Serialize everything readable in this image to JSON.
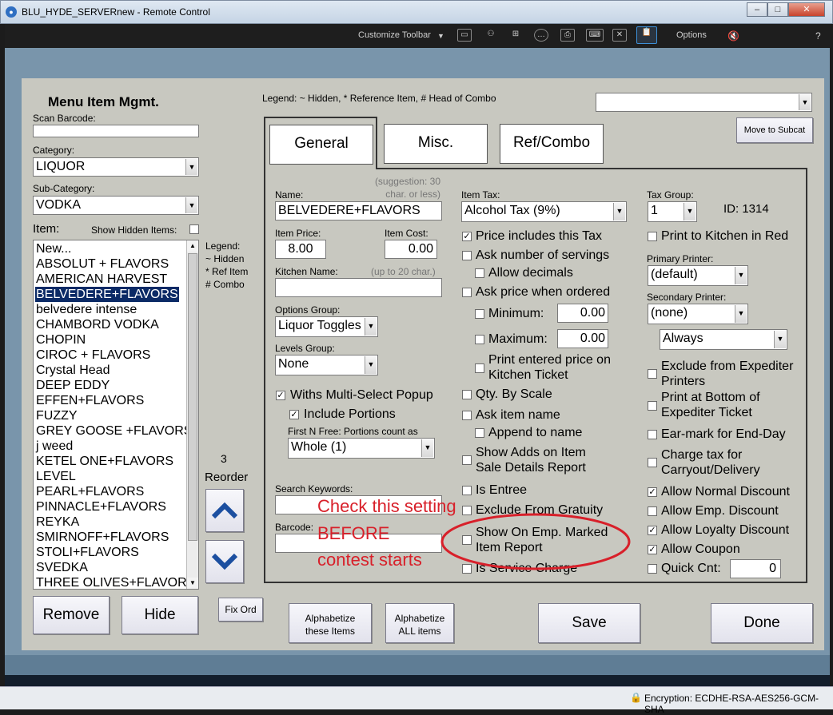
{
  "window": {
    "title": "BLU_HYDE_SERVERnew - Remote Control",
    "min": "–",
    "max": "□",
    "close": "✕"
  },
  "toolbar": {
    "customize": "Customize Toolbar",
    "options": "Options",
    "help": "?"
  },
  "status": {
    "encryption": "Encryption: ECDHE-RSA-AES256-GCM-SHA"
  },
  "left": {
    "title": "Menu Item Mgmt.",
    "scan_barcode_label": "Scan Barcode:",
    "category_label": "Category:",
    "category_value": "LIQUOR",
    "subcategory_label": "Sub-Category:",
    "subcategory_value": "VODKA",
    "item_label": "Item:",
    "show_hidden": "Show Hidden Items:",
    "items": [
      "New...",
      "ABSOLUT + FLAVORS",
      "AMERICAN HARVEST",
      "BELVEDERE+FLAVORS",
      "belvedere intense",
      "CHAMBORD VODKA",
      "CHOPIN",
      "CIROC + FLAVORS",
      "Crystal Head",
      "DEEP EDDY",
      "EFFEN+FLAVORS",
      "FUZZY",
      "GREY GOOSE +FLAVORS",
      "j weed",
      "KETEL ONE+FLAVORS",
      "LEVEL",
      "PEARL+FLAVORS",
      "PINNACLE+FLAVORS",
      "REYKA",
      "SMIRNOFF+FLAVORS",
      "STOLI+FLAVORS",
      "SVEDKA",
      "THREE OLIVES+FLAVORS"
    ],
    "legend": [
      "Legend:",
      "~ Hidden",
      "* Ref Item",
      "# Combo"
    ],
    "reorder_count": "3",
    "reorder_label": "Reorder",
    "fix_ord": "Fix Ord",
    "remove": "Remove",
    "hide": "Hide"
  },
  "header": {
    "legend": "Legend: ~ Hidden, * Reference Item, # Head of Combo",
    "move_subcat": "Move to Subcat"
  },
  "tabs": [
    "General",
    "Misc.",
    "Ref/Combo"
  ],
  "general": {
    "name_label": "Name:",
    "name_hint1": "(suggestion: 30",
    "name_hint2": "char. or less)",
    "name_value": "BELVEDERE+FLAVORS",
    "price_label": "Item Price:",
    "price_value": "8.00",
    "cost_label": "Item Cost:",
    "cost_value": "0.00",
    "kitchen_label": "Kitchen Name:",
    "kitchen_hint": "(up to 20 char.)",
    "options_label": "Options Group:",
    "options_value": "Liquor Toggles",
    "levels_label": "Levels Group:",
    "levels_value": "None",
    "withs": "Withs Multi-Select Popup",
    "include_portions": "Include Portions",
    "first_n": "First N Free: Portions count as",
    "portion_value": "Whole (1)",
    "search_label": "Search Keywords:",
    "barcode_label": "Barcode:",
    "tax_label": "Item Tax:",
    "tax_value": "Alcohol Tax (9%)",
    "price_incl": "Price includes this Tax",
    "ask_servings": "Ask number of servings",
    "allow_decimals": "Allow decimals",
    "ask_price": "Ask price when ordered",
    "minimum": "Minimum:",
    "minimum_value": "0.00",
    "maximum": "Maximum:",
    "maximum_value": "0.00",
    "print_price_1": "Print entered price on",
    "print_price_2": "Kitchen Ticket",
    "qty_scale": "Qty. By Scale",
    "ask_name": "Ask item name",
    "append_name": "Append to name",
    "show_adds_1": "Show Adds on Item",
    "show_adds_2": "Sale Details Report",
    "is_entree": "Is Entree",
    "exclude_gratuity": "Exclude From Gratuity",
    "show_emp_1": "Show On Emp. Marked",
    "show_emp_2": "Item Report",
    "is_service": "Is Service Charge",
    "taxgroup_label": "Tax Group:",
    "taxgroup_value": "1",
    "id_text": "ID: 1314",
    "print_red": "Print to Kitchen in Red",
    "primary_label": "Primary Printer:",
    "primary_value": "(default)",
    "secondary_label": "Secondary Printer:",
    "secondary_value": "(none)",
    "always_value": "Always",
    "exclude_exp_1": "Exclude from Expediter",
    "exclude_exp_2": "Printers",
    "print_bottom_1": "Print at Bottom of",
    "print_bottom_2": "Expediter Ticket",
    "earmark": "Ear-mark for End-Day",
    "charge_tax_1": "Charge tax for",
    "charge_tax_2": "Carryout/Delivery",
    "allow_normal": "Allow Normal Discount",
    "allow_emp": "Allow Emp. Discount",
    "allow_loyalty": "Allow Loyalty Discount",
    "allow_coupon": "Allow Coupon",
    "quick_cnt": "Quick Cnt:",
    "quick_cnt_value": "0"
  },
  "annotation": {
    "line1": "Check this setting",
    "line2": "BEFORE",
    "line3": "contest starts",
    "color": "#d8202a"
  },
  "bottom": {
    "alpha_these_1": "Alphabetize",
    "alpha_these_2": "these Items",
    "alpha_all_1": "Alphabetize",
    "alpha_all_2": "ALL items",
    "save": "Save",
    "done": "Done"
  }
}
